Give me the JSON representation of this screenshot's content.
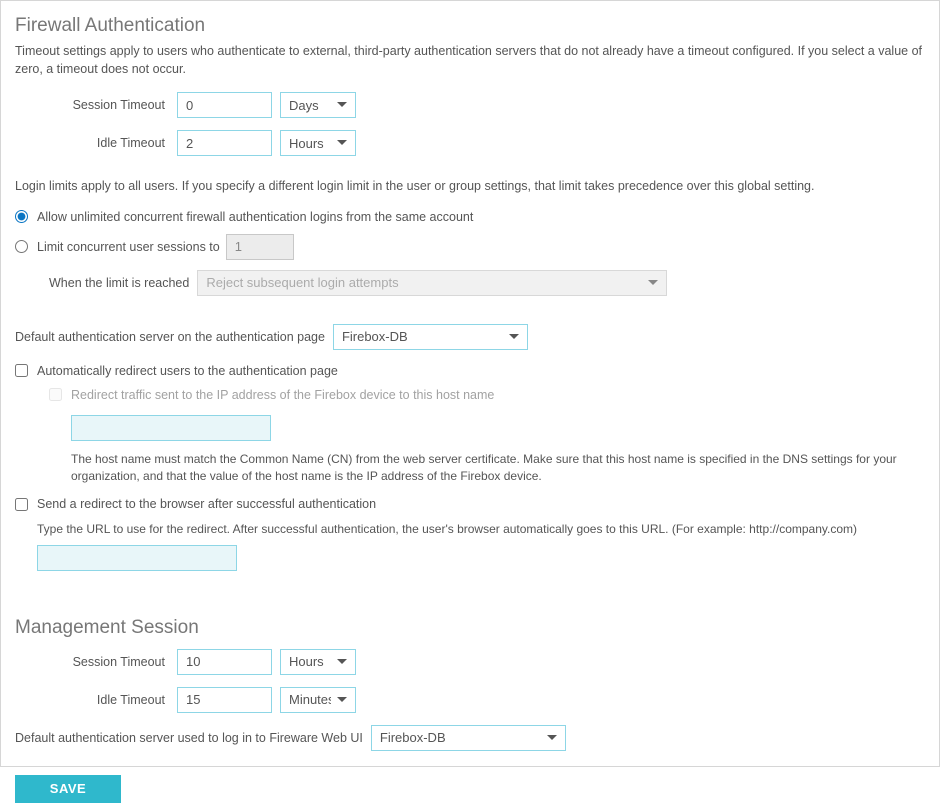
{
  "firewall": {
    "heading": "Firewall Authentication",
    "desc": "Timeout settings apply to users who authenticate to external, third-party authentication servers that do not already have a timeout configured. If you select a value of zero, a timeout does not occur.",
    "session_timeout_label": "Session Timeout",
    "session_timeout_value": "0",
    "session_timeout_unit": "Days",
    "idle_timeout_label": "Idle Timeout",
    "idle_timeout_value": "2",
    "idle_timeout_unit": "Hours",
    "login_limits_note": "Login limits apply to all users. If you specify a different login limit in the user or group settings, that limit takes precedence over this global setting.",
    "radio_unlimited": "Allow unlimited concurrent firewall authentication logins from the same account",
    "radio_limit": "Limit concurrent user sessions to",
    "limit_value": "1",
    "limit_reached_label": "When the limit is reached",
    "limit_reached_action": "Reject subsequent login attempts",
    "default_auth_server_label": "Default authentication server on the authentication page",
    "default_auth_server_value": "Firebox-DB",
    "auto_redirect_label": "Automatically redirect users to the authentication page",
    "redirect_traffic_label": "Redirect traffic sent to the IP address of the Firebox device to this host name",
    "redirect_hostname_value": "",
    "redirect_help": "The host name must match the Common Name (CN) from the web server certificate. Make sure that this host name is specified in the DNS settings for your organization, and that the value of the host name is the IP address of the Firebox device.",
    "send_redirect_label": "Send a redirect to the browser after successful authentication",
    "send_redirect_help": "Type the URL to use for the redirect. After successful authentication, the user's browser automatically goes to this URL. (For example: http://company.com)",
    "send_redirect_value": ""
  },
  "management": {
    "heading": "Management Session",
    "session_timeout_label": "Session Timeout",
    "session_timeout_value": "10",
    "session_timeout_unit": "Hours",
    "idle_timeout_label": "Idle Timeout",
    "idle_timeout_value": "15",
    "idle_timeout_unit": "Minutes",
    "default_auth_label": "Default authentication server used to log in to Fireware Web UI",
    "default_auth_value": "Firebox-DB"
  },
  "save_label": "SAVE"
}
